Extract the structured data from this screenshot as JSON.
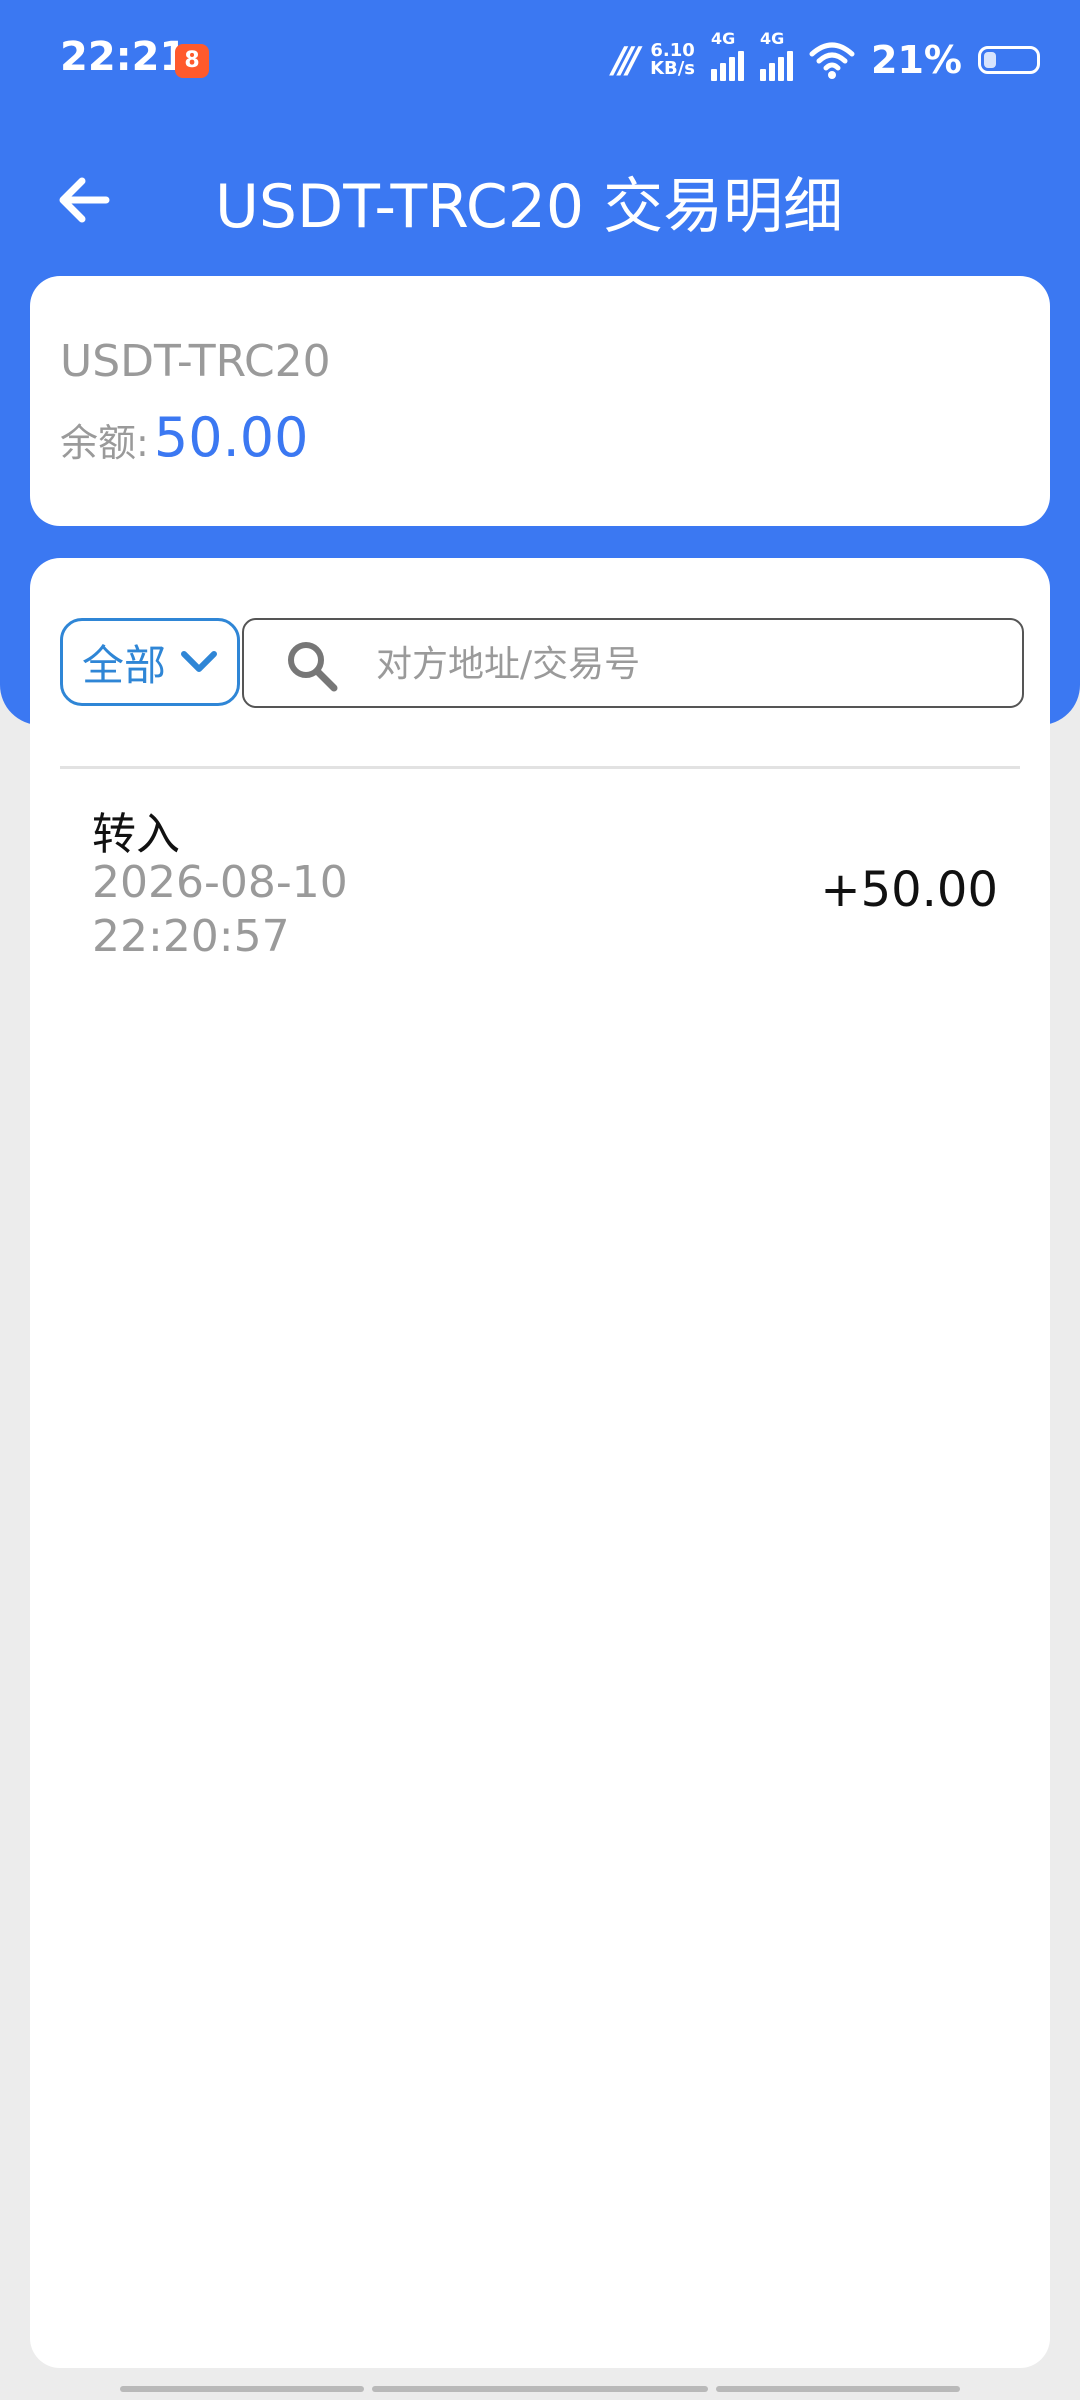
{
  "status": {
    "time": "22:21",
    "app_badge": "8",
    "net_speed_value": "6.10",
    "net_speed_unit": "KB/s",
    "sig1_label": "4G",
    "sig2_label": "4G",
    "battery": "21%"
  },
  "header": {
    "back_icon": "arrow-left-icon",
    "title": "USDT-TRC20 交易明细"
  },
  "balance": {
    "token": "USDT-TRC20",
    "label": "余额:",
    "value": "50.00"
  },
  "filter": {
    "selected": "全部",
    "chevron_icon": "chevron-down-icon"
  },
  "search": {
    "placeholder": "对方地址/交易号",
    "value": "",
    "icon": "search-icon"
  },
  "transactions": [
    {
      "type": "转入",
      "date": "2026-08-10",
      "time": "22:20:57",
      "amount": "+50.00"
    }
  ],
  "colors": {
    "primary": "#3b78f2",
    "accent": "#2f86d6",
    "muted_text": "#9a9a9a"
  }
}
